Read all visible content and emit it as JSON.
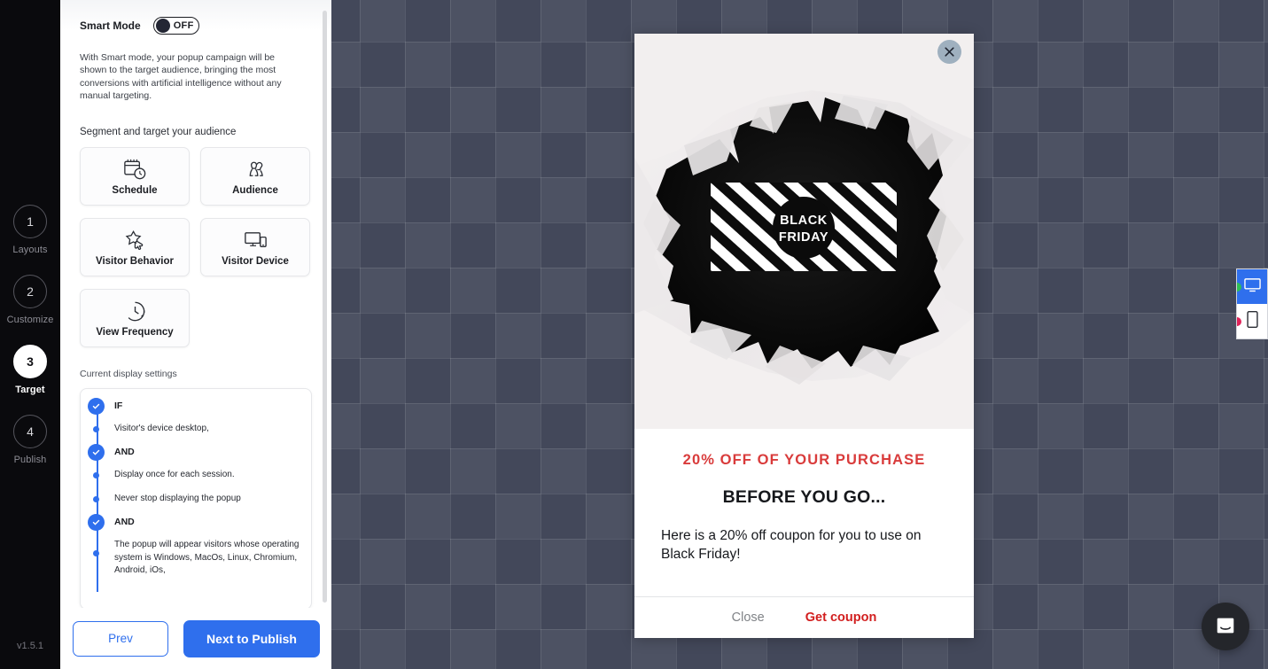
{
  "app": {
    "version_label": "v1.5.1"
  },
  "step_rail": {
    "steps": [
      {
        "number": "1",
        "label": "Layouts",
        "active": false
      },
      {
        "number": "2",
        "label": "Customize",
        "active": false
      },
      {
        "number": "3",
        "label": "Target",
        "active": true
      },
      {
        "number": "4",
        "label": "Publish",
        "active": false
      }
    ]
  },
  "settings": {
    "smart_mode": {
      "label": "Smart Mode",
      "state": "OFF",
      "description": "With Smart mode, your popup campaign will be shown to the target audience, bringing the most conversions with artificial intelligence without any manual targeting."
    },
    "segment_section_label": "Segment and target your audience",
    "segment_cards": [
      {
        "label": "Schedule",
        "icon": "calendar-clock-icon"
      },
      {
        "label": "Audience",
        "icon": "audience-people-icon"
      },
      {
        "label": "Visitor Behavior",
        "icon": "star-click-icon"
      },
      {
        "label": "Visitor Device",
        "icon": "monitor-phone-icon"
      },
      {
        "label": "View Frequency",
        "icon": "clock-refresh-icon"
      }
    ],
    "display_settings_label": "Current display settings",
    "display_rules": [
      {
        "type": "operator",
        "text": "IF"
      },
      {
        "type": "condition",
        "text": "Visitor's device desktop,"
      },
      {
        "type": "operator",
        "text": "AND"
      },
      {
        "type": "condition",
        "text": "Display once for each session."
      },
      {
        "type": "condition",
        "text": "Never stop displaying the popup"
      },
      {
        "type": "operator",
        "text": "AND"
      },
      {
        "type": "condition",
        "text": "The popup will appear visitors whose operating system is Windows, MacOs, Linux, Chromium, Android, iOs,"
      }
    ]
  },
  "footer": {
    "prev_label": "Prev",
    "next_label": "Next to Publish"
  },
  "popup": {
    "close_icon": "close-x-icon",
    "hero_badge_line1": "BLACK",
    "hero_badge_line2": "FRIDAY",
    "headline": "20% OFF OF YOUR PURCHASE",
    "subheadline": "BEFORE YOU GO...",
    "paragraph": "Here is a 20% off coupon for you to use on Black Friday!",
    "close_label": "Close",
    "coupon_label": "Get coupon"
  },
  "device_switcher": {
    "options": [
      {
        "icon": "desktop-monitor-icon",
        "active": true,
        "dot_color": "#2fbf55"
      },
      {
        "icon": "mobile-phone-icon",
        "active": false,
        "dot_color": "#e0245a"
      }
    ]
  },
  "chat": {
    "icon": "chat-bubble-icon"
  },
  "colors": {
    "accent_blue": "#2f6fed",
    "popup_red": "#d93b3b",
    "rail_black": "#0a0a0d",
    "canvas": "#474c5c"
  }
}
